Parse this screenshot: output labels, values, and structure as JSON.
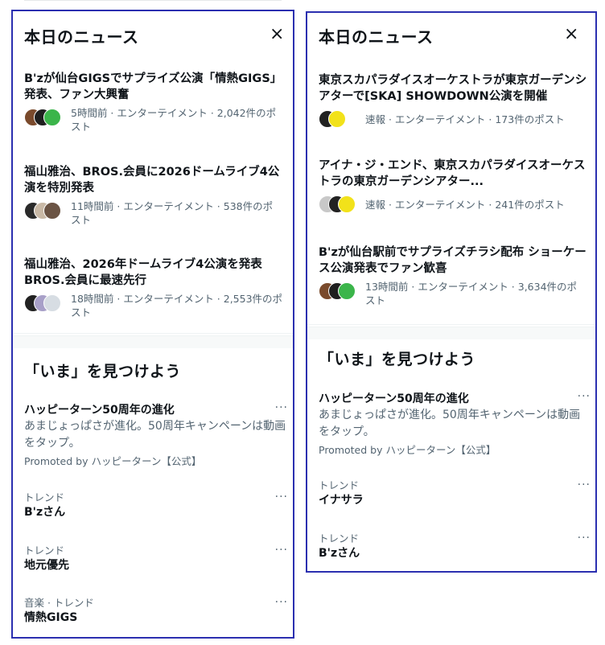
{
  "left_panel": {
    "news_title": "本日のニュース",
    "close_icon": "×",
    "news": [
      {
        "headline": "B'zが仙台GIGSでサプライズ公演「情熱GIGS」発表、ファン大興奮",
        "meta_line1": "5時間前 · エンターテイメント · 2,042件のポ",
        "meta_line2": "スト"
      },
      {
        "headline": "福山雅治、BROS.会員に2026ドームライブ4公演を特別発表",
        "meta_line1": "11時間前 · エンターテイメント · 538件のポ",
        "meta_line2": "スト"
      },
      {
        "headline": "福山雅治、2026年ドームライブ4公演を発表 BROS.会員に最速先行",
        "meta_line1": "18時間前 · エンターテイメント · 2,553件のポ",
        "meta_line2": "スト"
      }
    ],
    "discover_title": "「いま」を見つけよう",
    "promo": {
      "title": "ハッピーターン50周年の進化",
      "desc": "あまじょっぱさが進化。50周年キャンペーンは動画をタップ。",
      "promoted": "Promoted by ハッピーターン【公式】"
    },
    "trends": [
      {
        "label": "トレンド",
        "title": "B'zさん"
      },
      {
        "label": "トレンド",
        "title": "地元優先"
      },
      {
        "label": "音楽 · トレンド",
        "title": "情熱GIGS"
      }
    ],
    "more_icon": "···"
  },
  "right_panel": {
    "news_title": "本日のニュース",
    "close_icon": "×",
    "news": [
      {
        "headline": "東京スカパラダイスオーケストラが東京ガーデンシアターで[SKA] SHOWDOWN公演を開催",
        "meta_line1": "速報 · エンターテイメント · 173件のポスト",
        "meta_line2": ""
      },
      {
        "headline": "アイナ・ジ・エンド、東京スカパラダイスオーケストラの東京ガーデンシアター...",
        "meta_line1": "速報 · エンターテイメント · 241件のポスト",
        "meta_line2": ""
      },
      {
        "headline": "B'zが仙台駅前でサプライズチラシ配布 ショーケース公演発表でファン歓喜",
        "meta_line1": "13時間前 · エンターテイメント · 3,634件のポ",
        "meta_line2": "スト"
      }
    ],
    "discover_title": "「いま」を見つけよう",
    "promo": {
      "title": "ハッピーターン50周年の進化",
      "desc": "あまじょっぱさが進化。50周年キャンペーンは動画をタップ。",
      "promoted": "Promoted by ハッピーターン【公式】"
    },
    "trends": [
      {
        "label": "トレンド",
        "title": "イナサラ"
      },
      {
        "label": "トレンド",
        "title": "B'zさん"
      }
    ],
    "more_icon": "···"
  },
  "colors": {
    "border": "#2b2fb0",
    "text": "#0f1419",
    "secondary": "#536471"
  }
}
